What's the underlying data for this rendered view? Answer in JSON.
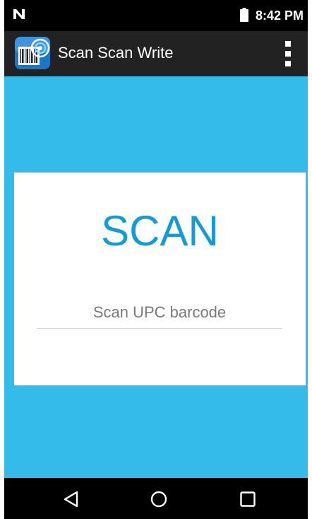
{
  "status_bar": {
    "time": "8:42 PM",
    "notification_icon": "n-logo-icon",
    "battery_icon": "battery-icon"
  },
  "app_bar": {
    "title": "Scan Scan Write",
    "logo_icon": "barcode-logo-icon",
    "menu_icon": "overflow-menu-icon"
  },
  "main": {
    "heading": "SCAN",
    "input": {
      "placeholder": "Scan UPC barcode",
      "value": ""
    }
  },
  "nav_bar": {
    "back_icon": "back-triangle-icon",
    "home_icon": "home-circle-icon",
    "recents_icon": "recents-square-icon"
  },
  "colors": {
    "background": "#34bbea",
    "accent_text": "#139bd8",
    "app_bar": "#222222",
    "system_bars": "#000000"
  }
}
